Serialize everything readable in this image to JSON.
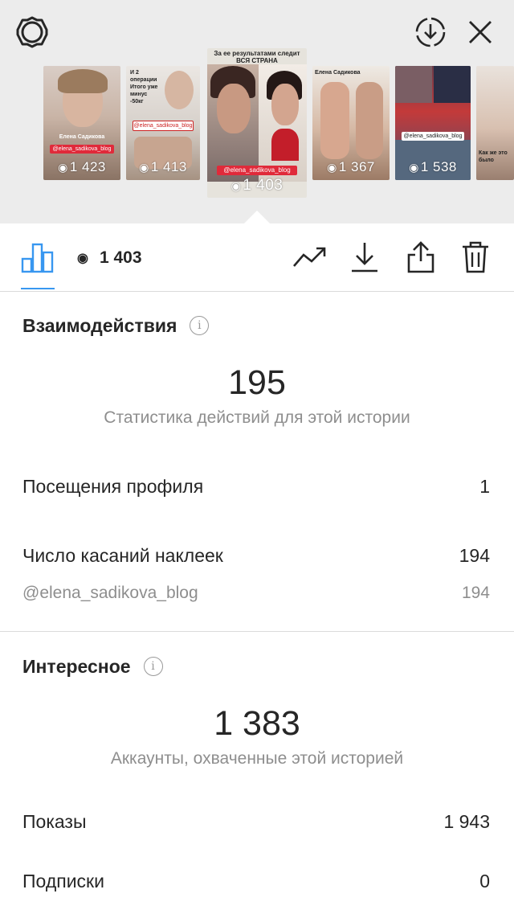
{
  "header": {
    "icons": {
      "settings": "gear-icon",
      "download_circle": "download-circle-icon",
      "close": "close-icon"
    }
  },
  "stories": [
    {
      "views": "1 423",
      "caption": "Елена Садикова",
      "tag": "@elena_sadikova_blog",
      "colors": [
        "#c9b4a6",
        "#8a7364"
      ]
    },
    {
      "views": "1 413",
      "caption": "И 2 операции Итого уже минус -50кг",
      "tag": "@elena_sadikova_blog",
      "colors": [
        "#d8d2cc",
        "#a69282"
      ]
    },
    {
      "views": "1 403",
      "caption": "За ее результатами следит ВСЯ СТРАНА",
      "tag": "@elena_sadikova_blog",
      "colors": [
        "#e6e3dc",
        "#4d3a33"
      ],
      "selected": true
    },
    {
      "views": "1 367",
      "caption": "Елена Садикова",
      "tag": "",
      "colors": [
        "#d6b9a5",
        "#9c7b66"
      ]
    },
    {
      "views": "1 538",
      "caption": "@elena_sadikova_blog",
      "tag": "@elena_sadikova_blog",
      "colors": [
        "#c33a3a",
        "#4c4f6e"
      ]
    },
    {
      "views": "",
      "caption": "Как же это было",
      "tag": "",
      "colors": [
        "#d8c0b0",
        "#9a7f70"
      ]
    }
  ],
  "tabs": {
    "views": "1 403",
    "icons": [
      "bar-chart-icon",
      "eye-icon",
      "trending-icon",
      "download-icon",
      "share-icon",
      "trash-icon"
    ]
  },
  "interactions": {
    "title": "Взаимодействия",
    "total": "195",
    "caption": "Статистика действий для этой истории",
    "rows": [
      {
        "label": "Посещения профиля",
        "value": "1"
      },
      {
        "label": "Число касаний наклеек",
        "value": "194"
      },
      {
        "label": "@elena_sadikova_blog",
        "value": "194"
      }
    ]
  },
  "discovery": {
    "title": "Интересное",
    "total": "1 383",
    "caption": "Аккаунты, охваченные этой историей",
    "rows": [
      {
        "label": "Показы",
        "value": "1 943"
      },
      {
        "label": "Подписки",
        "value": "0"
      }
    ]
  },
  "colors": {
    "accent": "#3897f0",
    "tag_red": "#e02a3a",
    "strip_bg": "#ececec",
    "muted": "#8e8e8e"
  }
}
